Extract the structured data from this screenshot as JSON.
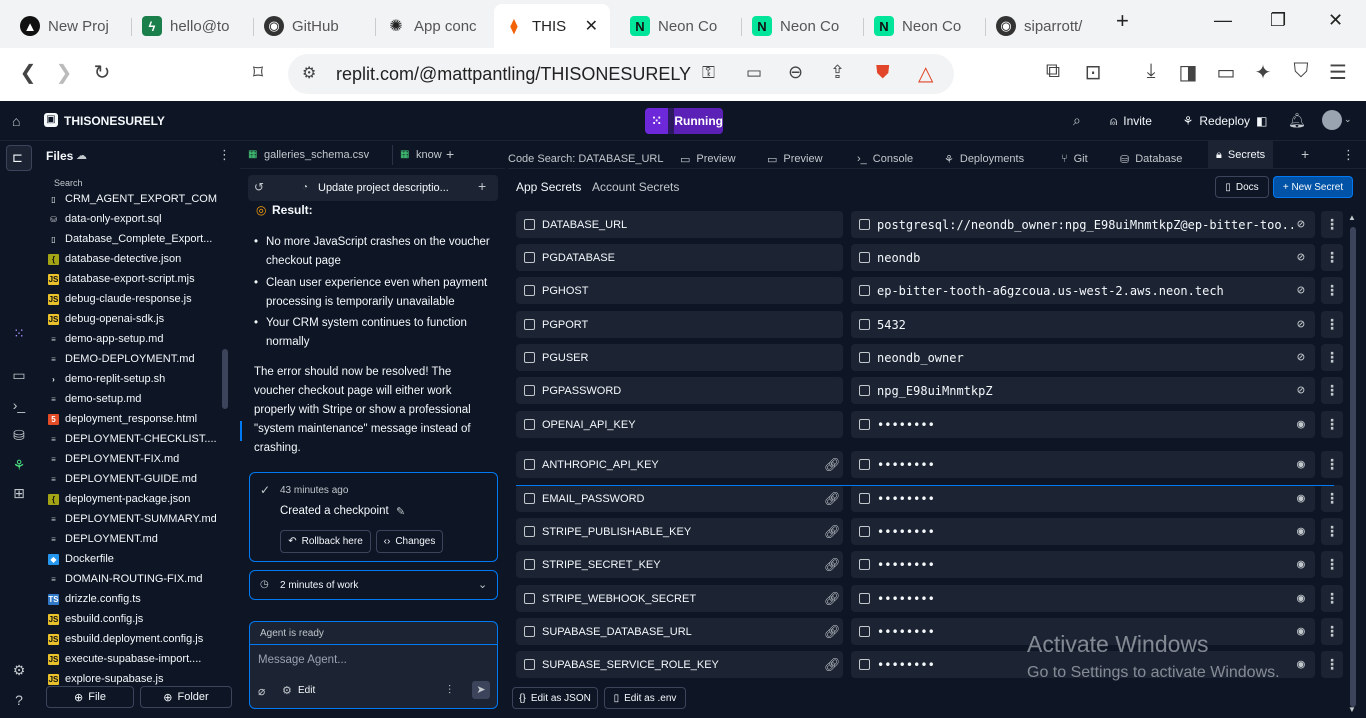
{
  "browser": {
    "tabs": [
      {
        "title": "New Proj",
        "icon": "vercel-icon"
      },
      {
        "title": "hello@to",
        "icon": "bolt-icon"
      },
      {
        "title": "GitHub",
        "icon": "github-icon"
      },
      {
        "title": "App conc",
        "icon": "chatgpt-icon"
      },
      {
        "title": "THIS",
        "icon": "replit-icon"
      },
      {
        "title": "Neon Co",
        "icon": "neon-icon"
      },
      {
        "title": "Neon Co",
        "icon": "neon-icon"
      },
      {
        "title": "Neon Co",
        "icon": "neon-icon"
      },
      {
        "title": "siparrott/",
        "icon": "github-icon"
      }
    ],
    "url": "replit.com/@mattpantling/THISONESURELY"
  },
  "app": {
    "project_name": "THISONESURELY",
    "run_label": "Running",
    "invite_label": "Invite",
    "redeploy_label": "Redeploy"
  },
  "files": {
    "title": "Files",
    "search_label": "Search",
    "items": [
      {
        "name": "CRM_AGENT_EXPORT_COM...",
        "type": "file"
      },
      {
        "name": "data-only-export.sql",
        "type": "sql"
      },
      {
        "name": "Database_Complete_Export...",
        "type": "file"
      },
      {
        "name": "database-detective.json",
        "type": "json"
      },
      {
        "name": "database-export-script.mjs",
        "type": "js"
      },
      {
        "name": "debug-claude-response.js",
        "type": "js"
      },
      {
        "name": "debug-openai-sdk.js",
        "type": "js"
      },
      {
        "name": "demo-app-setup.md",
        "type": "md"
      },
      {
        "name": "DEMO-DEPLOYMENT.md",
        "type": "md"
      },
      {
        "name": "demo-replit-setup.sh",
        "type": "sh"
      },
      {
        "name": "demo-setup.md",
        "type": "md"
      },
      {
        "name": "deployment_response.html",
        "type": "html"
      },
      {
        "name": "DEPLOYMENT-CHECKLIST....",
        "type": "md"
      },
      {
        "name": "DEPLOYMENT-FIX.md",
        "type": "md"
      },
      {
        "name": "DEPLOYMENT-GUIDE.md",
        "type": "md"
      },
      {
        "name": "deployment-package.json",
        "type": "json"
      },
      {
        "name": "DEPLOYMENT-SUMMARY.md",
        "type": "md"
      },
      {
        "name": "DEPLOYMENT.md",
        "type": "md"
      },
      {
        "name": "Dockerfile",
        "type": "docker"
      },
      {
        "name": "DOMAIN-ROUTING-FIX.md",
        "type": "md"
      },
      {
        "name": "drizzle.config.ts",
        "type": "ts"
      },
      {
        "name": "esbuild.config.js",
        "type": "js"
      },
      {
        "name": "esbuild.deployment.config.js",
        "type": "js"
      },
      {
        "name": "execute-supabase-import....",
        "type": "js"
      },
      {
        "name": "explore-supabase.js",
        "type": "js"
      }
    ],
    "new_file_label": "File",
    "new_folder_label": "Folder"
  },
  "agent": {
    "tab_galleries": "galleries_schema.csv",
    "tab_know": "know",
    "header_title": "Update project descriptio...",
    "result_heading": "Result:",
    "bullets": [
      "No more JavaScript crashes on the voucher checkout page",
      "Clean user experience even when payment processing is temporarily unavailable",
      "Your CRM system continues to function normally"
    ],
    "summary": "The error should now be resolved! The voucher checkout page will either work properly with Stripe or show a professional \"system maintenance\" message instead of crashing.",
    "checkpoint_time": "43 minutes ago",
    "checkpoint_text": "Created a checkpoint",
    "rollback_label": "Rollback here",
    "changes_label": "Changes",
    "work_label": "2 minutes of work",
    "status_label": "Agent is ready",
    "message_placeholder": "Message Agent...",
    "edit_label": "Edit"
  },
  "main": {
    "tabs": [
      {
        "label": "Code Search: DATABASE_URL"
      },
      {
        "label": "Preview"
      },
      {
        "label": "Preview"
      },
      {
        "label": "Console"
      },
      {
        "label": "Deployments"
      },
      {
        "label": "Git"
      },
      {
        "label": "Database"
      },
      {
        "label": "Secrets"
      }
    ],
    "subtabs": [
      "App Secrets",
      "Account Secrets"
    ],
    "docs_label": "Docs",
    "new_secret_label": "+ New Secret",
    "secrets": [
      {
        "key": "DATABASE_URL",
        "value": "postgresql://neondb_owner:npg_E98uiMnmtkpZ@ep-bitter-too...",
        "linked": false,
        "visible": true
      },
      {
        "key": "PGDATABASE",
        "value": "neondb",
        "linked": false,
        "visible": true
      },
      {
        "key": "PGHOST",
        "value": "ep-bitter-tooth-a6gzcoua.us-west-2.aws.neon.tech",
        "linked": false,
        "visible": true
      },
      {
        "key": "PGPORT",
        "value": "5432",
        "linked": false,
        "visible": true
      },
      {
        "key": "PGUSER",
        "value": "neondb_owner",
        "linked": false,
        "visible": true
      },
      {
        "key": "PGPASSWORD",
        "value": "npg_E98uiMnmtkpZ",
        "linked": false,
        "visible": true
      },
      {
        "key": "OPENAI_API_KEY",
        "value": "••••••••",
        "linked": false,
        "visible": false
      },
      {
        "key": "ANTHROPIC_API_KEY",
        "value": "••••••••",
        "linked": true,
        "visible": false
      },
      {
        "key": "EMAIL_PASSWORD",
        "value": "••••••••",
        "linked": true,
        "visible": false
      },
      {
        "key": "STRIPE_PUBLISHABLE_KEY",
        "value": "••••••••",
        "linked": true,
        "visible": false
      },
      {
        "key": "STRIPE_SECRET_KEY",
        "value": "••••••••",
        "linked": true,
        "visible": false
      },
      {
        "key": "STRIPE_WEBHOOK_SECRET",
        "value": "••••••••",
        "linked": true,
        "visible": false
      },
      {
        "key": "SUPABASE_DATABASE_URL",
        "value": "••••••••",
        "linked": true,
        "visible": false
      },
      {
        "key": "SUPABASE_SERVICE_ROLE_KEY",
        "value": "••••••••",
        "linked": true,
        "visible": false
      }
    ],
    "edit_json_label": "Edit as JSON",
    "edit_env_label": "Edit as .env"
  },
  "watermark": {
    "line1": "Activate Windows",
    "line2": "Go to Settings to activate Windows."
  },
  "colors": {
    "accent": "#0053a6",
    "running_pill": "#5b21b6",
    "bg": "#0e1525",
    "surface": "#1c2333"
  }
}
